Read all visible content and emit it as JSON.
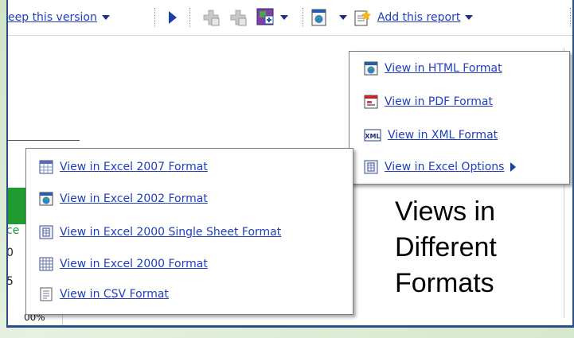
{
  "toolbar": {
    "keep_version_label": "eep this version",
    "add_report_label": "Add this report"
  },
  "format_menu": {
    "items": [
      {
        "label": "View in HTML Format",
        "icon": "html-format-icon"
      },
      {
        "label": "View in PDF Format",
        "icon": "pdf-format-icon"
      },
      {
        "label": "View in XML Format",
        "icon": "xml-format-icon"
      },
      {
        "label": "View in Excel Options",
        "icon": "excel-options-icon"
      }
    ]
  },
  "excel_submenu": {
    "items": [
      {
        "label": "View in Excel 2007 Format",
        "icon": "excel-2007-icon"
      },
      {
        "label": "View in Excel 2002 Format",
        "icon": "excel-2002-icon"
      },
      {
        "label": "View in Excel 2000 Single Sheet Format",
        "icon": "excel-2000-single-sheet-icon"
      },
      {
        "label": "View in Excel 2000 Format",
        "icon": "excel-2000-icon"
      },
      {
        "label": "View in CSV Format",
        "icon": "csv-format-icon"
      }
    ]
  },
  "page_fragments": {
    "frag1": "ce",
    "frag2": "0",
    "frag3": "5",
    "frag4": "00%"
  },
  "caption": {
    "line1": "Views in",
    "line2": "Different",
    "line3": "Formats"
  },
  "colors": {
    "link": "#1f3fbf",
    "frame_border": "#2b4f88",
    "accent_green": "#1f9b2f"
  }
}
